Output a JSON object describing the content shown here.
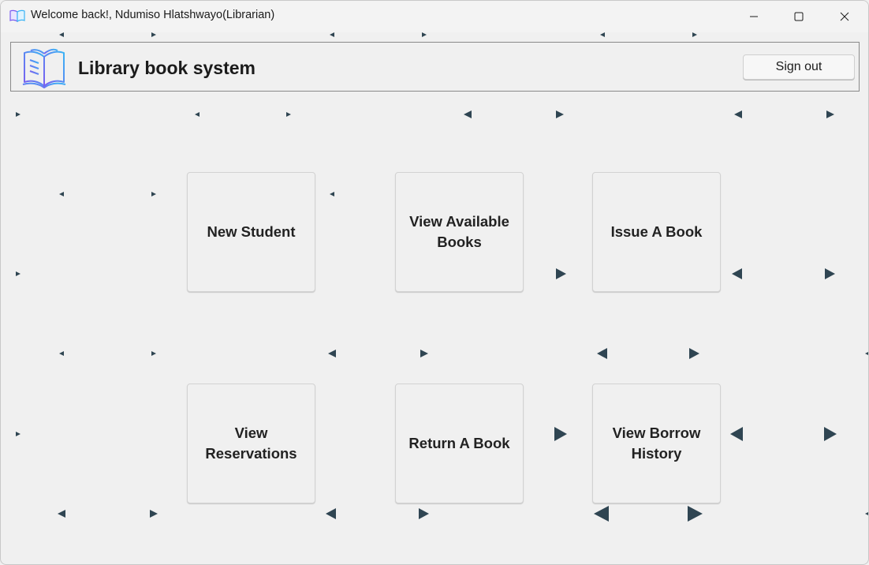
{
  "window": {
    "title": "Welcome back!, Ndumiso Hlatshwayo(Librarian)",
    "app_icon": "open-book-icon",
    "controls": [
      "minimize-icon",
      "maximize-icon",
      "close-icon"
    ]
  },
  "header": {
    "logo_icon": "open-book-logo-icon",
    "title": "Library book system",
    "signout_label": "Sign out"
  },
  "tiles": [
    {
      "label": "New Student"
    },
    {
      "label": "View Available Books"
    },
    {
      "label": "Issue A Book"
    },
    {
      "label": "View Reservations"
    },
    {
      "label": "Return A Book"
    },
    {
      "label": "View Borrow History"
    }
  ],
  "colors": {
    "background": "#f0f0f0",
    "arrow": "#2f4552",
    "logo_gradient": [
      "#7b5cf0",
      "#3ab4f5"
    ]
  }
}
